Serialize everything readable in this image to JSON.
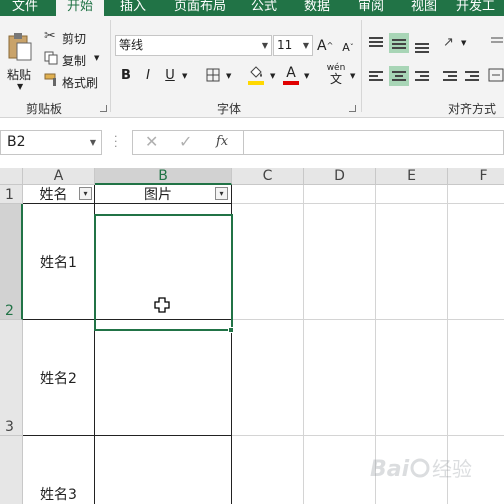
{
  "ribbon_tabs": [
    "文件",
    "开始",
    "插入",
    "页面布局",
    "公式",
    "数据",
    "审阅",
    "视图",
    "开发工"
  ],
  "active_tab": "开始",
  "clipboard": {
    "paste": "粘贴",
    "cut": "剪切",
    "copy": "复制",
    "format_painter": "格式刷",
    "group": "剪贴板"
  },
  "font": {
    "name": "等线",
    "size": "11",
    "bold": "B",
    "italic": "I",
    "underline": "U",
    "grow": "A",
    "shrink": "A",
    "font_color": "A",
    "wen": "wén",
    "wen_char": "文",
    "group": "字体"
  },
  "alignment": {
    "group": "对齐方式"
  },
  "formula_bar": {
    "name_box": "B2",
    "fx": "fx",
    "value": ""
  },
  "columns": [
    "A",
    "B",
    "C",
    "D",
    "E",
    "F"
  ],
  "rows": [
    "1",
    "2",
    "3"
  ],
  "sheet": {
    "header": {
      "a": "姓名",
      "b": "图片"
    },
    "names": [
      "姓名1",
      "姓名2",
      "姓名3"
    ]
  },
  "colors": {
    "accent": "#217346",
    "selection_fill": "#a8d5b6",
    "highlight": "#ffd800",
    "font_red": "#e00000"
  },
  "watermark": "Baidu 经验"
}
